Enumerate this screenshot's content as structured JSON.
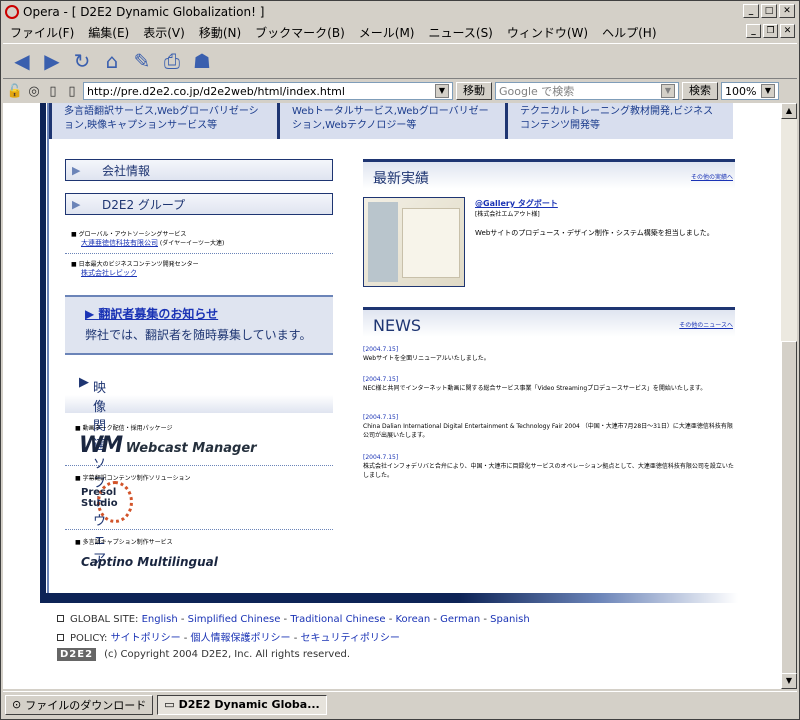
{
  "window": {
    "title": "Opera - [ D2E2 Dynamic Globalization! ]"
  },
  "menu": [
    "ファイル(F)",
    "編集(E)",
    "表示(V)",
    "移動(N)",
    "ブックマーク(B)",
    "メール(M)",
    "ニュース(S)",
    "ウィンドウ(W)",
    "ヘルプ(H)"
  ],
  "toolbar": {
    "address": "http://pre.d2e2.co.jp/d2e2web/html/index.html",
    "go_label": "移動",
    "search_placeholder": "Google で検索",
    "search_label": "検索",
    "zoom": "100%"
  },
  "topnav": [
    "多言語翻訳サービス,Webグローバリゼーション,映像キャプションサービス等",
    "Webトータルサービス,Webグローバリゼーション,Webテクノロジー等",
    "テクニカルトレーニング教材開発,ビジネスコンテンツ開発等"
  ],
  "left": {
    "company_info": "会社情報",
    "group": "D2E2 グループ",
    "group_items": [
      {
        "desc": "グローバル・アウトソーシングサービス",
        "link": "大連亜徳信科技有限公司",
        "suffix": "(ダイヤーイーツー大連)"
      },
      {
        "desc": "日本最大のビジネスコンテンツ開発センター",
        "link": "株式会社レビック",
        "suffix": ""
      }
    ],
    "recruit_title": "翻訳者募集のお知らせ",
    "recruit_body": "弊社では、翻訳者を随時募集しています。",
    "video_title": "映像関連ソフトウェア",
    "software": [
      {
        "desc": "動画ネーク配信・採用パッケージ",
        "name": "Webcast Manager"
      },
      {
        "desc": "字幕翻訳コンテンツ制作ソリューション",
        "name": "Presol Studio"
      },
      {
        "desc": "多言語キャプション制作サービス",
        "name": "Captino Multilingual"
      }
    ]
  },
  "right": {
    "results_title": "最新実績",
    "results_more": "その他の実績へ",
    "gallery_title": "@Gallery タグボート",
    "gallery_company": "[株式会社エムアウト様]",
    "gallery_desc": "Webサイトのプロデュース・デザイン制作・システム構築を担当しました。",
    "news_title": "NEWS",
    "news_more": "その他のニュースへ",
    "news": [
      {
        "date": "[2004.7.15]",
        "text": "Webサイトを全面リニューアルいたしました。"
      },
      {
        "date": "[2004.7.15]",
        "text": "NEC様と共同でインターネット動画に関する総合サービス事業「Video Streamingプロデュースサービス」を開始いたします。"
      },
      {
        "date": "[2004.7.15]",
        "text": "China Dalian International Digital Entertainment & Technology Fair 2004 （中国・大連市7月28日～31日）に大連亜徳信科技有限公司が出展いたします。"
      },
      {
        "date": "[2004.7.15]",
        "text": "株式会社インフォデリバと合弁により、中国・大連市に目録化サービスのオペレーション拠点として、大連亜徳信科技有限公司を設立いたしました。"
      }
    ]
  },
  "footer": {
    "global_label": "GLOBAL SITE:",
    "global_links": [
      "English",
      "Simplified Chinese",
      "Traditional Chinese",
      "Korean",
      "German",
      "Spanish"
    ],
    "policy_label": "POLICY:",
    "policy_links": [
      "サイトポリシー",
      "個人情報保護ポリシー",
      "セキュリティポリシー"
    ],
    "logo": "D2E2",
    "copyright": "(c) Copyright 2004 D2E2, Inc. All rights reserved."
  },
  "taskbar": [
    "ファイルのダウンロード",
    "D2E2 Dynamic Globa..."
  ]
}
